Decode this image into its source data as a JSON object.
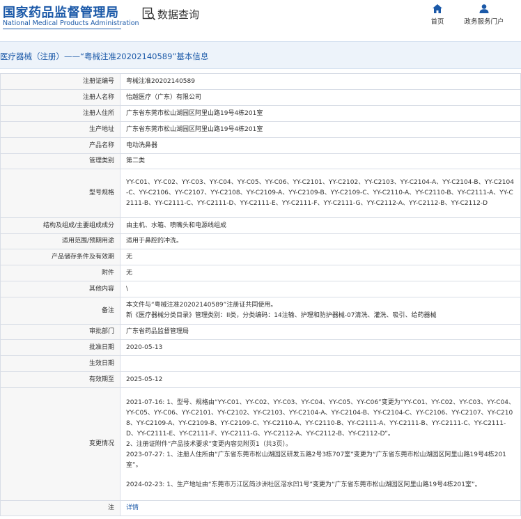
{
  "header": {
    "logo_cn": "国家药品监督管理局",
    "logo_en": "National Medical Products Administration",
    "db_title": "数据查询",
    "nav": [
      {
        "label": "首页",
        "icon": "home-icon"
      },
      {
        "label": "政务服务门户",
        "icon": "user-icon"
      }
    ]
  },
  "title": "医疗器械（注册）——“粤械注准20202140589”基本信息",
  "rows": [
    {
      "label": "注册证编号",
      "value": "粤械注准20202140589"
    },
    {
      "label": "注册人名称",
      "value": "怡越医疗（广东）有限公司"
    },
    {
      "label": "注册人住所",
      "value": "广东省东莞市松山湖园区阿里山路19号4栋201室"
    },
    {
      "label": "生产地址",
      "value": "广东省东莞市松山湖园区阿里山路19号4栋201室"
    },
    {
      "label": "产品名称",
      "value": "电动洗鼻器"
    },
    {
      "label": "管理类别",
      "value": "第二类"
    },
    {
      "label": "型号规格",
      "value": "YY-C01、YY-C02、YY-C03、YY-C04、YY-C05、YY-C06、YY-C2101、YY-C2102、YY-C2103、YY-C2104-A、YY-C2104-B、YY-C2104-C、YY-C2106、YY-C2107、YY-C2108、YY-C2109-A、YY-C2109-B、YY-C2109-C、YY-C2110-A、YY-C2110-B、YY-C2111-A、YY-C2111-B、YY-C2111-C、YY-C2111-D、YY-C2111-E、YY-C2111-F、YY-C2111-G、YY-C2112-A、YY-C2112-B、YY-C2112-D"
    },
    {
      "label": "结构及组成/主要组成成分",
      "value": "由主机、水箱、喷嘴头和电源线组成"
    },
    {
      "label": "适用范围/预期用途",
      "value": "适用于鼻腔的冲洗。"
    },
    {
      "label": "产品储存条件及有效期",
      "value": "无"
    },
    {
      "label": "附件",
      "value": "无"
    },
    {
      "label": "其他内容",
      "value": "\\"
    },
    {
      "label": "备注",
      "value_line1": "本文件与“粤械注准20202140589”注册证共同使用。",
      "value_line2": "新《医疗器械分类目录》管理类别：II类，分类编码：14注输、护理和防护器械-07清洗、灌洗、吸引、给药器械"
    },
    {
      "label": "审批部门",
      "value": "广东省药品监督管理局"
    },
    {
      "label": "批准日期",
      "value": "2020-05-13"
    },
    {
      "label": "生效日期",
      "value": ""
    },
    {
      "label": "有效期至",
      "value": "2025-05-12"
    },
    {
      "label": "变更情况",
      "change1": "2021-07-16: 1、型号、规格由“YY-C01、YY-C02、YY-C03、YY-C04、YY-C05、YY-C06”变更为“YY-C01、YY-C02、YY-C03、YY-C04、YY-C05、YY-C06、YY-C2101、YY-C2102、YY-C2103、YY-C2104-A、YY-C2104-B、YY-C2104-C、YY-C2106、YY-C2107、YY-C2108、YY-C2109-A、YY-C2109-B、YY-C2109-C、YY-C2110-A、YY-C2110-B、YY-C2111-A、YY-C2111-B、YY-C2111-C、YY-C2111-D、YY-C2111-E、YY-C2111-F、YY-C2111-G、YY-C2112-A、YY-C2112-B、YY-C2112-D”。",
      "change1b": "2、注册证附件“产品技术要求”变更内容见附页1（共3页）。",
      "change2": "2023-07-27: 1、注册人住所由“广东省东莞市松山湖园区研发五路2号3栋707室”变更为“广东省东莞市松山湖园区阿里山路19号4栋201室”。",
      "change3": "2024-02-23: 1、生产地址由“东莞市万江区简沙洲社区滘水凹1号”变更为“广东省东莞市松山湖园区阿里山路19号4栋201室”。"
    },
    {
      "label": "注",
      "value": "详情"
    }
  ],
  "colors": {
    "brand_blue": "#1b59a8",
    "title_bar_bg": "#edf3fa",
    "label_bg": "#f7f7f7",
    "border": "#d8dde6"
  }
}
